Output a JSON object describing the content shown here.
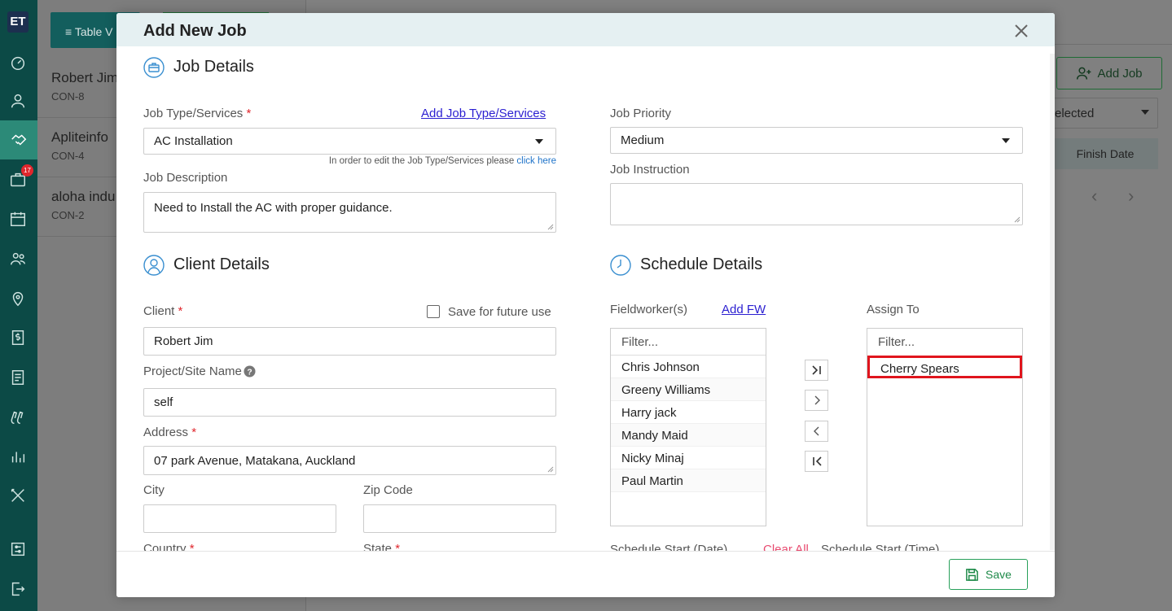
{
  "app": {
    "logo": "ET",
    "notification_count": "17",
    "table_button_label": "Table V",
    "contacts": [
      {
        "name": "Robert Jim",
        "code": "CON-8"
      },
      {
        "name": "Apliteinfo",
        "code": "CON-4"
      },
      {
        "name": "aloha indu",
        "code": "CON-2"
      }
    ],
    "add_job_label": "Add Job",
    "filter_select_value": "elected",
    "finish_date_header": "Finish Date"
  },
  "modal": {
    "title": "Add New Job",
    "save_label": "Save"
  },
  "job_details": {
    "title": "Job Details",
    "job_type_label": "Job Type/Services",
    "add_job_type_link": "Add Job Type/Services",
    "job_type_value": "AC Installation",
    "job_type_hint": "In order to edit the Job Type/Services please",
    "job_type_hint_link": "click here",
    "job_description_label": "Job Description",
    "job_description_value": "Need to Install the AC with proper guidance.",
    "job_priority_label": "Job Priority",
    "job_priority_value": "Medium",
    "job_instruction_label": "Job Instruction",
    "job_instruction_value": ""
  },
  "client_details": {
    "title": "Client Details",
    "client_label": "Client",
    "save_future_label": "Save for future use",
    "client_value": "Robert Jim",
    "project_site_label": "Project/Site Name",
    "project_site_value": "self",
    "address_label": "Address",
    "address_value": "07 park Avenue, Matakana, Auckland",
    "city_label": "City",
    "city_value": "",
    "zip_label": "Zip Code",
    "zip_value": "",
    "country_label": "Country",
    "state_label": "State"
  },
  "schedule_details": {
    "title": "Schedule Details",
    "fieldworkers_label": "Fieldworker(s)",
    "add_fw_link": "Add FW",
    "assign_to_label": "Assign To",
    "filter_placeholder": "Filter...",
    "fieldworkers": [
      "Chris Johnson",
      "Greeny Williams",
      "Harry jack",
      "Mandy Maid",
      "Nicky Minaj",
      "Paul Martin"
    ],
    "assigned": [
      "Cherry Spears"
    ],
    "schedule_start_date_label": "Schedule Start (Date)",
    "clear_all_label": "Clear All",
    "schedule_start_time_label": "Schedule Start (Time)"
  },
  "colors": {
    "sidebar": "#0c4a46",
    "sidebar_active": "#2c8a78",
    "required": "#e0272d",
    "link": "#2b1fd1",
    "save_green": "#1e8a49",
    "highlight_red": "#e0151d",
    "clear_all": "#e84a6f"
  }
}
